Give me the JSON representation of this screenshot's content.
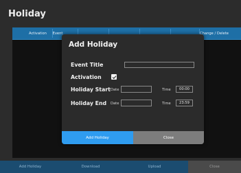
{
  "page": {
    "title": "Holiday"
  },
  "table": {
    "columns": [
      "Activation",
      "Event",
      "",
      "",
      "",
      "",
      "Change / Delete"
    ]
  },
  "modal": {
    "title": "Add Holiday",
    "event_title_label": "Event Title",
    "event_title_value": "",
    "activation_label": "Activation",
    "activation_checked": true,
    "holiday_start_label": "Holiday Start",
    "holiday_end_label": "Holiday End",
    "date_label": "Date",
    "time_label": "Time",
    "start_date": "",
    "start_time": "00:00",
    "end_date": "",
    "end_time": "23:59",
    "add_button": "Add Holiday",
    "close_button": "Close"
  },
  "bottom_bar": {
    "add": "Add Holiday",
    "download": "Download",
    "upload": "Upload",
    "close": "Close"
  },
  "colors": {
    "accent": "#2f9cf0",
    "header": "#1e6fa6",
    "close_button": "#7d7d7d"
  }
}
